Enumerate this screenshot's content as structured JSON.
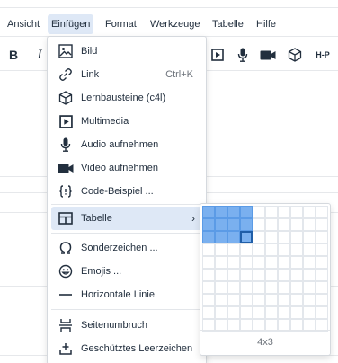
{
  "menubar": {
    "items": [
      {
        "label": "Ansicht"
      },
      {
        "label": "Einfügen"
      },
      {
        "label": "Format"
      },
      {
        "label": "Werkzeuge"
      },
      {
        "label": "Tabelle"
      },
      {
        "label": "Hilfe"
      }
    ],
    "active": "Einfügen"
  },
  "toolbar": {
    "bold": "B",
    "italic": "I",
    "h5p": "H-P",
    "icons": [
      "bold-icon",
      "italic-icon",
      "multimedia-icon",
      "microphone-icon",
      "video-camera-icon",
      "cube-icon",
      "h5p-icon"
    ]
  },
  "menu": {
    "items": [
      {
        "label": "Bild",
        "icon": "image-icon"
      },
      {
        "label": "Link",
        "shortcut": "Ctrl+K",
        "icon": "link-icon"
      },
      {
        "label": "Lernbausteine (c4l)",
        "icon": "cube-icon"
      },
      {
        "label": "Multimedia",
        "icon": "multimedia-icon"
      },
      {
        "label": "Audio aufnehmen",
        "icon": "microphone-icon"
      },
      {
        "label": "Video aufnehmen",
        "icon": "video-camera-icon"
      },
      {
        "label": "Code-Beispiel ...",
        "icon": "code-icon"
      },
      {
        "label": "Tabelle",
        "icon": "table-icon",
        "submenu": true
      },
      {
        "label": "Sonderzeichen ...",
        "icon": "omega-icon"
      },
      {
        "label": "Emojis ...",
        "icon": "emoji-icon"
      },
      {
        "label": "Horizontale Linie",
        "icon": "horizontal-line-icon"
      },
      {
        "label": "Seitenumbruch",
        "icon": "page-break-icon"
      },
      {
        "label": "Geschütztes Leerzeichen",
        "icon": "nonbreaking-space-icon"
      }
    ],
    "chevron": "›",
    "highlighted": "Tabelle"
  },
  "table_picker": {
    "columns": 4,
    "rows": 3,
    "label": "4x3"
  },
  "colors": {
    "highlight": "#dee8f6",
    "cell_selected": "#7ab0ef",
    "cell_current_border": "#1f5ea8",
    "text": "#222f3e"
  }
}
